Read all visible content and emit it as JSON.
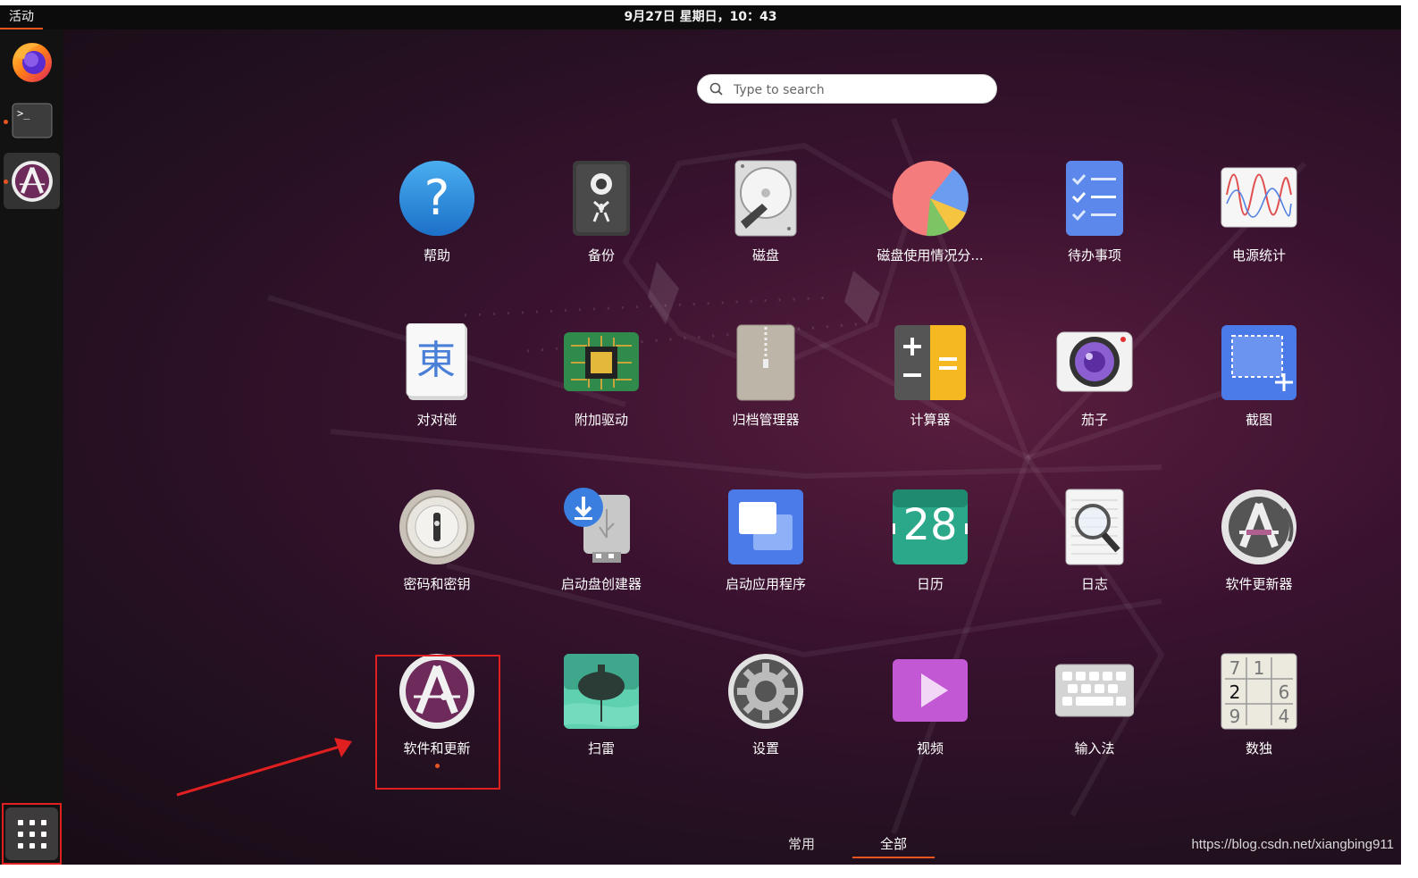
{
  "topbar": {
    "activities": "活动",
    "clock": "9月27日 星期日，10：43"
  },
  "dock": {
    "items": [
      {
        "name": "firefox",
        "icon": "firefox-icon",
        "running": false
      },
      {
        "name": "terminal",
        "icon": "terminal-icon",
        "running": true
      },
      {
        "name": "software-updater",
        "icon": "software-updater-icon",
        "running": true,
        "active": true
      }
    ],
    "show_apps_icon": "grid-icon"
  },
  "search": {
    "placeholder": "Type to search"
  },
  "apps": [
    {
      "label": "帮助",
      "icon": "help-icon"
    },
    {
      "label": "备份",
      "icon": "backup-icon"
    },
    {
      "label": "磁盘",
      "icon": "disks-icon"
    },
    {
      "label": "磁盘使用情况分...",
      "icon": "disk-usage-icon"
    },
    {
      "label": "待办事项",
      "icon": "todo-icon"
    },
    {
      "label": "电源统计",
      "icon": "power-statistics-icon"
    },
    {
      "label": "对对碰",
      "icon": "mahjongg-icon"
    },
    {
      "label": "附加驱动",
      "icon": "additional-drivers-icon"
    },
    {
      "label": "归档管理器",
      "icon": "archive-manager-icon"
    },
    {
      "label": "计算器",
      "icon": "calculator-icon"
    },
    {
      "label": "茄子",
      "icon": "cheese-icon"
    },
    {
      "label": "截图",
      "icon": "screenshot-icon"
    },
    {
      "label": "密码和密钥",
      "icon": "passwords-keys-icon"
    },
    {
      "label": "启动盘创建器",
      "icon": "startup-disk-creator-icon"
    },
    {
      "label": "启动应用程序",
      "icon": "startup-applications-icon"
    },
    {
      "label": "日历",
      "icon": "calendar-icon",
      "day": "28"
    },
    {
      "label": "日志",
      "icon": "logs-icon"
    },
    {
      "label": "软件更新器",
      "icon": "software-updater-icon"
    },
    {
      "label": "软件和更新",
      "icon": "software-updates-icon",
      "running": true
    },
    {
      "label": "扫雷",
      "icon": "mines-icon"
    },
    {
      "label": "设置",
      "icon": "settings-icon"
    },
    {
      "label": "视频",
      "icon": "videos-icon"
    },
    {
      "label": "输入法",
      "icon": "input-method-icon"
    },
    {
      "label": "数独",
      "icon": "sudoku-icon",
      "digits": [
        "7",
        "1",
        "2",
        "6",
        "9",
        "4"
      ]
    }
  ],
  "tabs": {
    "frequent": "常用",
    "all": "全部",
    "selected": "all"
  },
  "watermark": "https://blog.csdn.net/xiangbing911",
  "colors": {
    "accent": "#e95420",
    "annotation": "#e02020"
  }
}
